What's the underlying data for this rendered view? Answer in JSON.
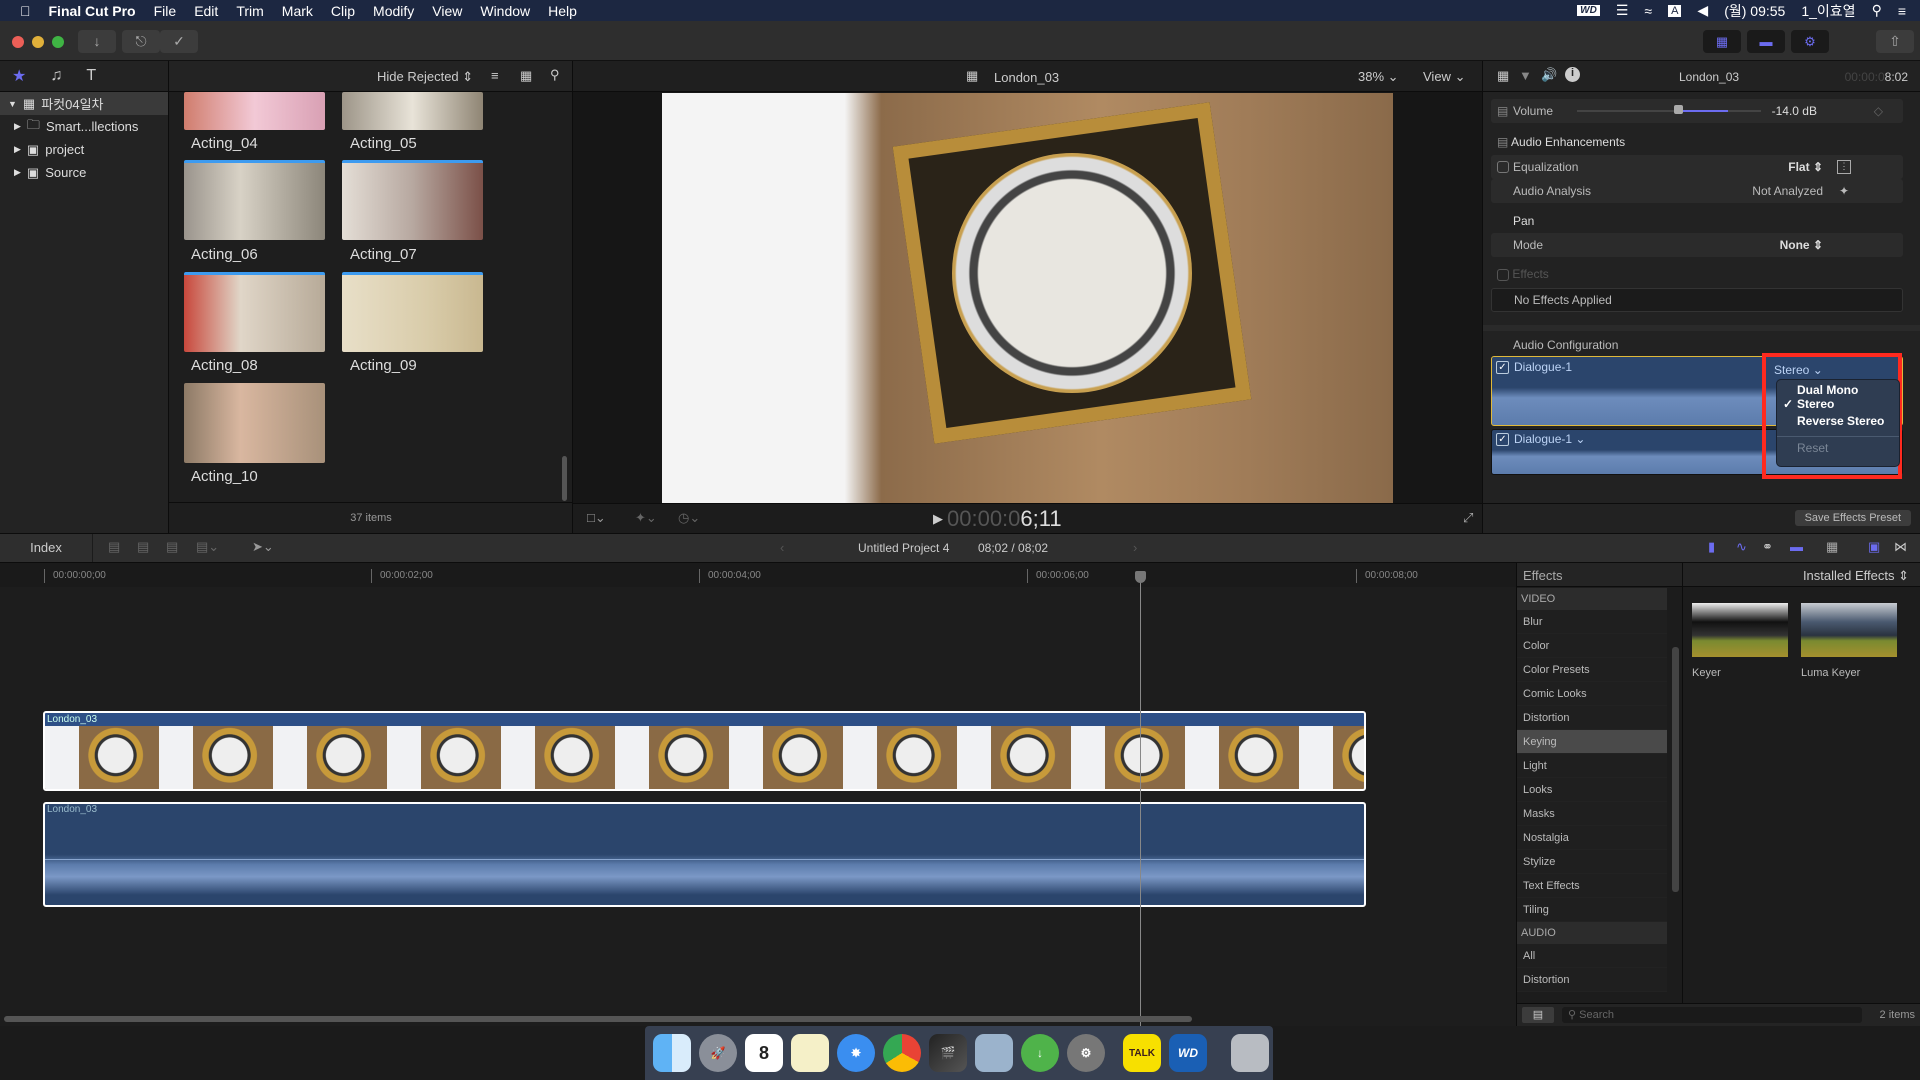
{
  "menubar": {
    "app": "Final Cut Pro",
    "items": [
      "File",
      "Edit",
      "Trim",
      "Mark",
      "Clip",
      "Modify",
      "View",
      "Window",
      "Help"
    ],
    "clock": "(월) 09:55",
    "user": "1_이효열",
    "input_source": "A"
  },
  "sidebar": {
    "library": "파컷04일차",
    "items": [
      {
        "label": "Smart...llections",
        "icon": "folder-icon"
      },
      {
        "label": "project",
        "icon": "star-event-icon"
      },
      {
        "label": "Source",
        "icon": "star-event-icon"
      }
    ]
  },
  "browser": {
    "filter": "Hide Rejected",
    "count": "37 items",
    "clips": [
      "Acting_04",
      "Acting_05",
      "Acting_06",
      "Acting_07",
      "Acting_08",
      "Acting_09",
      "Acting_10"
    ]
  },
  "viewer": {
    "clip_name": "London_03",
    "zoom": "38%",
    "view_label": "View",
    "timecode_dim": "00:00:0",
    "timecode_bright": "6;11"
  },
  "inspector": {
    "clip_name": "London_03",
    "duration_dim": "00:00:0",
    "duration_bright": "8:02",
    "volume_label": "Volume",
    "volume_value": "-14.0  dB",
    "volume_level": 0.55,
    "enhancements": "Audio Enhancements",
    "equalization": "Equalization",
    "equalization_value": "Flat",
    "analysis": "Audio Analysis",
    "analysis_value": "Not Analyzed",
    "pan": "Pan",
    "mode": "Mode",
    "mode_value": "None",
    "effects": "Effects",
    "no_effects": "No Effects Applied",
    "audio_config": "Audio Configuration",
    "channels": [
      {
        "label": "Dialogue-1",
        "config": "Stereo",
        "checked": true
      },
      {
        "label": "Dialogue-1",
        "checked": true
      }
    ],
    "dropdown": {
      "options": [
        "Dual Mono",
        "Stereo",
        "Reverse Stereo"
      ],
      "selected": "Stereo",
      "reset": "Reset"
    },
    "save_preset": "Save Effects Preset",
    "highlight_color": "#ff2a1f",
    "accent": "#6c6cf0"
  },
  "timeline": {
    "index_label": "Index",
    "project": "Untitled Project 4",
    "duration": "08;02 / 08;02",
    "ruler": [
      "00:00:00;00",
      "00:00:02;00",
      "00:00:04;00",
      "00:00:06;00",
      "00:00:08;00"
    ],
    "video_clip": "London_03",
    "audio_clip": "London_03",
    "playhead_time": "6;11"
  },
  "effects": {
    "title": "Effects",
    "source": "Installed Effects",
    "video_header": "VIDEO",
    "video": [
      "Blur",
      "Color",
      "Color Presets",
      "Comic Looks",
      "Distortion",
      "Keying",
      "Light",
      "Looks",
      "Masks",
      "Nostalgia",
      "Stylize",
      "Text Effects",
      "Tiling"
    ],
    "selected": "Keying",
    "audio_header": "AUDIO",
    "audio": [
      "All",
      "Distortion"
    ],
    "results": [
      "Keyer",
      "Luma Keyer"
    ],
    "search_placeholder": "Search",
    "count": "2 items"
  },
  "dock": {
    "apps": [
      "Finder",
      "Launchpad",
      "Calendar",
      "Notes",
      "Safari",
      "Chrome",
      "Final Cut Pro",
      "Preview",
      "Download",
      "System Preferences",
      "KakaoTalk",
      "WD",
      "Trash"
    ],
    "calendar_day": "8",
    "kakao": "TALK",
    "wd": "WD"
  }
}
